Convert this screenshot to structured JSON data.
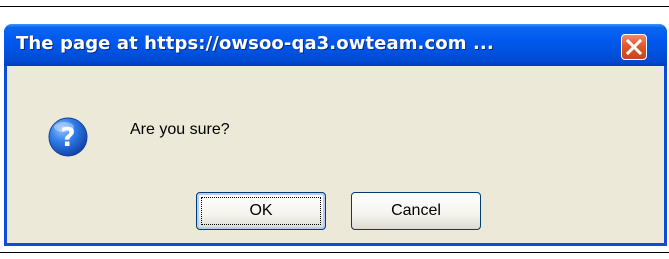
{
  "window": {
    "title": "The page at https://owsoo-qa3.owteam.com ...",
    "close_icon": "close-x-icon"
  },
  "dialog": {
    "icon": "question-icon",
    "message": "Are you sure?"
  },
  "buttons": {
    "ok_label": "OK",
    "cancel_label": "Cancel"
  },
  "colors": {
    "titlebar": "#0054e3",
    "frame": "#0a4dd8",
    "body": "#ece9d8",
    "close": "#e2572c"
  }
}
